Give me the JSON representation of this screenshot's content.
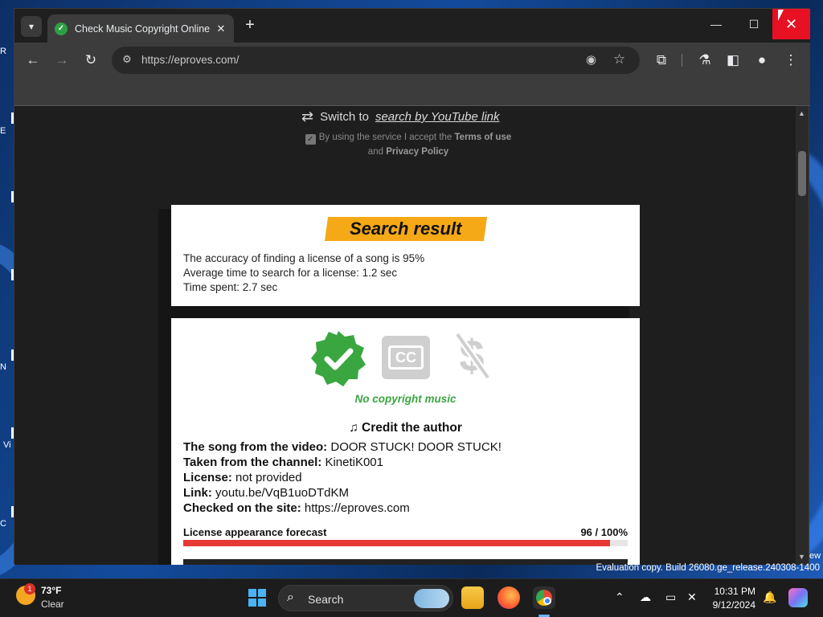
{
  "desktop": {
    "left_labels": [
      "R",
      "E",
      "N",
      "Vi",
      "C"
    ],
    "evaluation_text": "Evaluation copy. Build 26080.ge_release.240308-1400",
    "edge_label": "ew"
  },
  "browser": {
    "tab_title": "Check Music Copyright Online",
    "url": "https://eproves.com/"
  },
  "page": {
    "switch_prefix": "Switch to",
    "switch_link": "search by YouTube link",
    "terms_prefix": "By using the service I accept the",
    "terms_link": "Terms of use",
    "terms_and": "and",
    "privacy_link": "Privacy Policy",
    "result_title": "Search result",
    "accuracy_line": "The accuracy of finding a license of a song is 95%",
    "avg_time_line": "Average time to search for a license: 1.2 sec",
    "time_spent_line": "Time spent: 2.7 sec",
    "no_copyright": "No copyright music",
    "cc_label": "CC",
    "credit_title": "Credit the author",
    "song_label": "The song from the video:",
    "song_value": "DOOR STUCK! DOOR STUCK!",
    "channel_label": "Taken from the channel:",
    "channel_value": "KinetiK001",
    "license_label": "License:",
    "license_value": "not provided",
    "link_label": "Link:",
    "link_value": "youtu.be/VqB1uoDTdKM",
    "checked_label": "Checked on the site:",
    "checked_value": "https://eproves.com",
    "forecast_label": "License appearance forecast",
    "forecast_value": "96 / 100%",
    "forecast_fraction": 0.96
  },
  "colors": {
    "accent_orange": "#f5a917",
    "success_green": "#3aa640",
    "forecast_red": "#e53935",
    "close_red": "#e81123"
  },
  "taskbar": {
    "weather_temp": "73°F",
    "weather_cond": "Clear",
    "weather_badge": "1",
    "search_placeholder": "Search",
    "time": "10:31 PM",
    "date": "9/12/2024"
  }
}
